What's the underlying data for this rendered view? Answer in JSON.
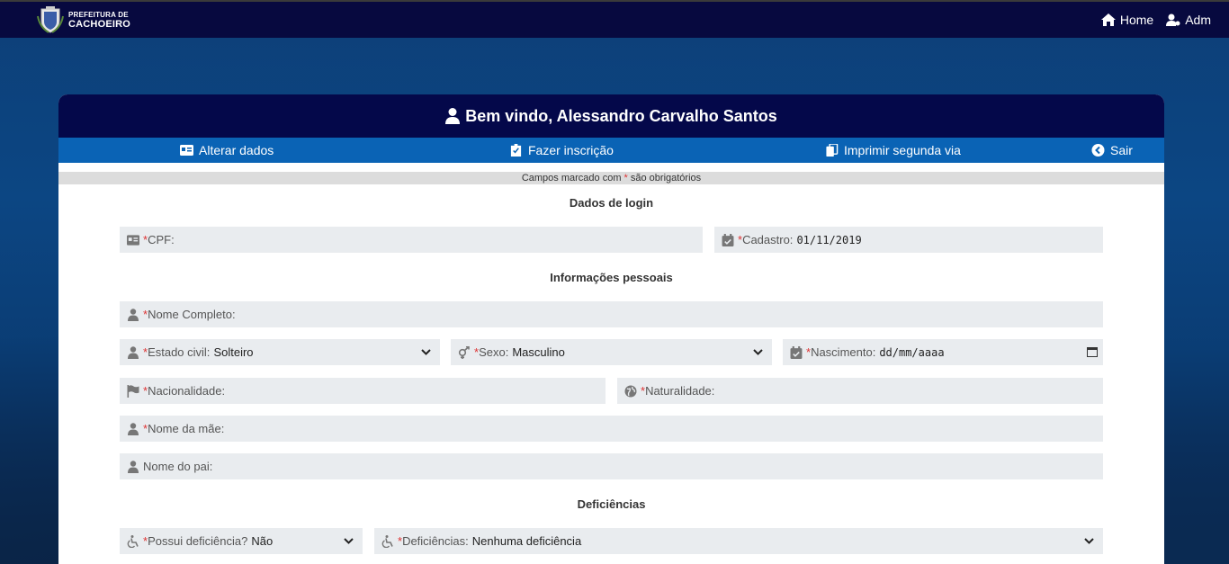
{
  "topbar": {
    "brand_line1": "PREFEITURA DE",
    "brand_line2": "CACHOEIRO",
    "nav": [
      {
        "label": "Home",
        "icon": "home-icon"
      },
      {
        "label": "Adm",
        "icon": "users-cog-icon"
      }
    ]
  },
  "header": {
    "welcome": "Bem vindo, Alessandro Carvalho Santos"
  },
  "actions": [
    {
      "label": "Alterar dados",
      "icon": "id-card-icon"
    },
    {
      "label": "Fazer inscrição",
      "icon": "clipboard-check-icon"
    },
    {
      "label": "Imprimir segunda via",
      "icon": "copy-icon"
    },
    {
      "label": "Sair",
      "icon": "chevron-circle-left-icon"
    }
  ],
  "notice": {
    "before": "Campos marcado com ",
    "star": "*",
    "after": " são obrigatórios"
  },
  "sections": {
    "login": "Dados de login",
    "personal": "Informações pessoais",
    "disabilities": "Deficiências"
  },
  "fields": {
    "cpf": {
      "label": "CPF:",
      "value": ""
    },
    "cadastro": {
      "label": "Cadastro:",
      "value": "01/11/2019"
    },
    "nome_completo": {
      "label": "Nome Completo:",
      "value": ""
    },
    "estado_civil": {
      "label": "Estado civil:",
      "value": "Solteiro"
    },
    "sexo": {
      "label": "Sexo:",
      "value": "Masculino"
    },
    "nascimento": {
      "label": "Nascimento:",
      "value": "dd/mm/aaaa"
    },
    "nacionalidade": {
      "label": "Nacionalidade:",
      "value": ""
    },
    "naturalidade": {
      "label": "Naturalidade:",
      "value": ""
    },
    "nome_mae": {
      "label": "Nome da mãe:",
      "value": ""
    },
    "nome_pai": {
      "label": "Nome do pai:",
      "value": ""
    },
    "possui_deficiencia": {
      "label": "Possui deficiência?",
      "value": "Não"
    },
    "deficiencias": {
      "label": "Deficiências:",
      "value": "Nenhuma deficiência"
    }
  },
  "required_marker": "*",
  "colors": {
    "topbar": "#07093f",
    "card_header": "#04084a",
    "action_bar": "#0a63b5",
    "required": "#dd3333",
    "field_bg": "#e9ecef"
  }
}
